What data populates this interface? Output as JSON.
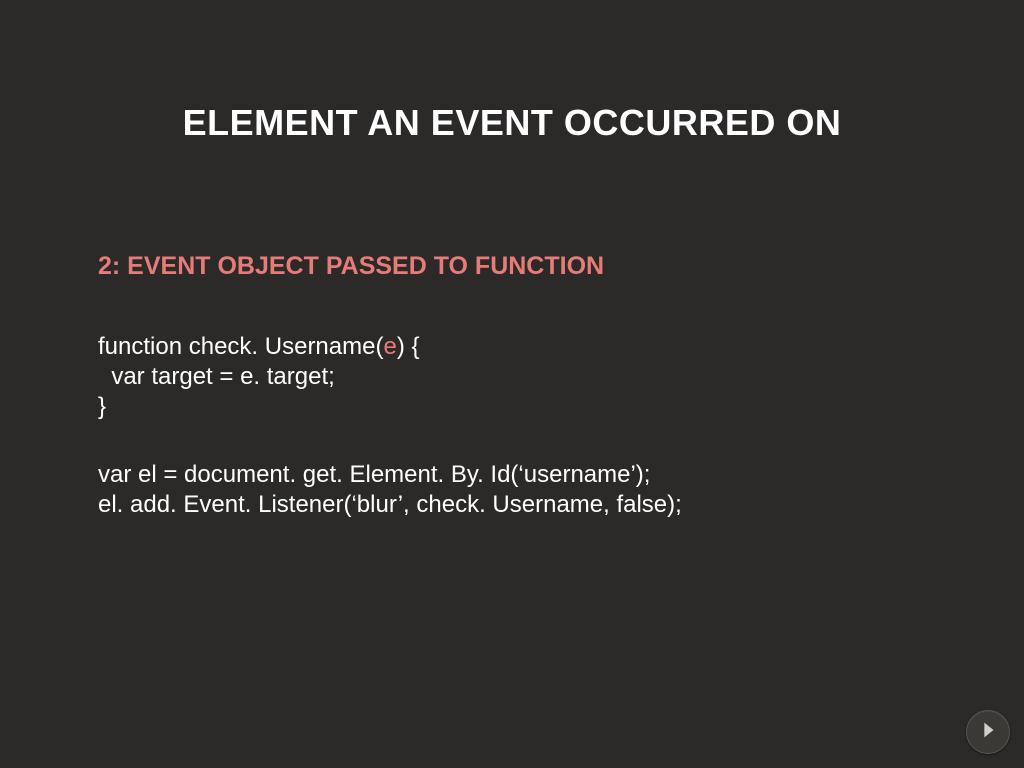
{
  "title": "ELEMENT AN EVENT OCCURRED ON",
  "subtitle": "2: EVENT OBJECT PASSED TO FUNCTION",
  "code1": {
    "l1a": "function check. Username(",
    "l1b": "e",
    "l1c": ") {",
    "l2": "  var target = e. target;",
    "l3": "}"
  },
  "code2": {
    "l1": "var el = document. get. Element. By. Id(‘username’);",
    "l2": "el. add. Event. Listener(‘blur’, check. Username, false);"
  },
  "icons": {
    "next": "next-arrow-icon"
  }
}
